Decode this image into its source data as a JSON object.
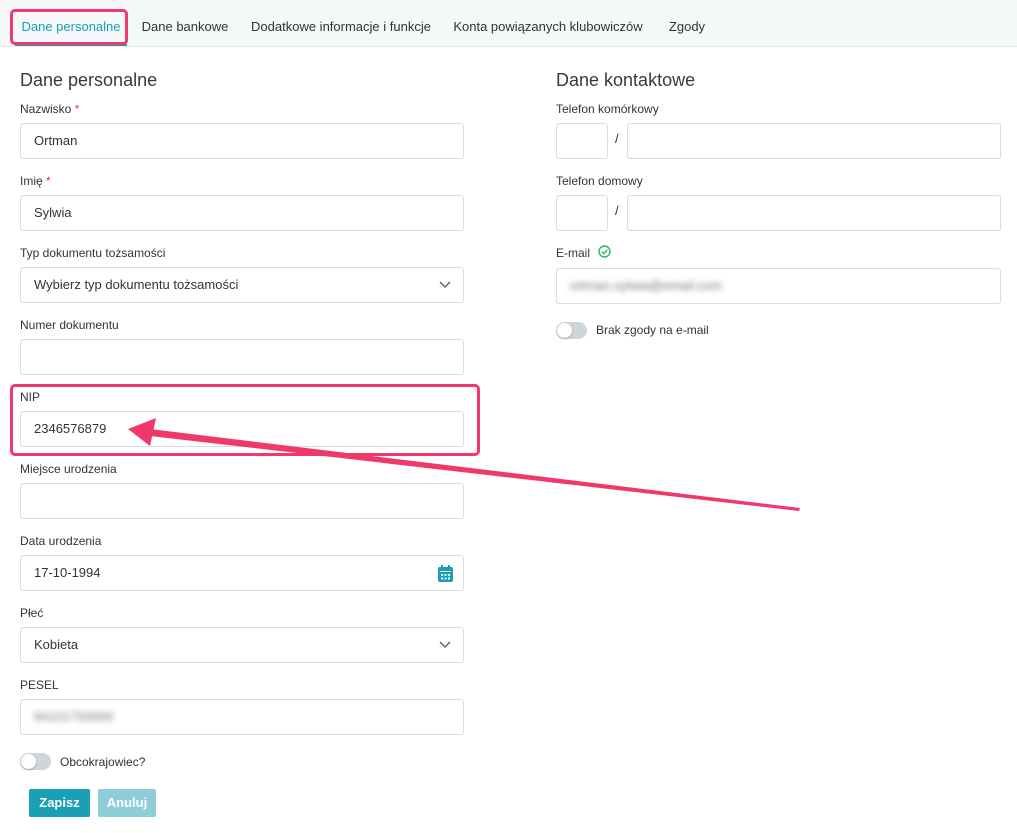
{
  "tabs": [
    {
      "label": "Dane personalne",
      "active": true
    },
    {
      "label": "Dane bankowe"
    },
    {
      "label": "Dodatkowe informacje i funkcje"
    },
    {
      "label": "Konta powiązanych klubowiczów"
    },
    {
      "label": "Zgody"
    }
  ],
  "personal": {
    "title": "Dane personalne",
    "surname": {
      "label": "Nazwisko",
      "required_mark": "*",
      "value": "Ortman"
    },
    "first_name": {
      "label": "Imię",
      "required_mark": "*",
      "value": "Sylwia"
    },
    "id_doc_type": {
      "label": "Typ dokumentu tożsamości",
      "value": "Wybierz typ dokumentu tożsamości"
    },
    "doc_number": {
      "label": "Numer dokumentu",
      "value": ""
    },
    "nip": {
      "label": "NIP",
      "value": "2346576879"
    },
    "birthplace": {
      "label": "Miejsce urodzenia",
      "value": ""
    },
    "birthdate": {
      "label": "Data urodzenia",
      "value": "17-10-1994"
    },
    "gender": {
      "label": "Płeć",
      "value": "Kobieta"
    },
    "pesel": {
      "label": "PESEL",
      "value": "94101700000"
    },
    "foreigner": {
      "label": "Obcokrajowiec?",
      "on": false
    }
  },
  "contact": {
    "title": "Dane kontaktowe",
    "mobile": {
      "label": "Telefon komórkowy",
      "prefix": "",
      "number": "",
      "separator": "/"
    },
    "home": {
      "label": "Telefon domowy",
      "prefix": "",
      "number": "",
      "separator": "/"
    },
    "email": {
      "label": "E-mail",
      "value": "ortman.sylwia@email.com"
    },
    "no_email_consent": {
      "label": "Brak zgody na e-mail",
      "on": false
    }
  },
  "actions": {
    "save": "Zapisz",
    "cancel": "Anuluj"
  },
  "colors": {
    "accent": "#1a9fb5",
    "highlight": "#f0386b",
    "required": "#e53935",
    "verified": "#2eb85c"
  }
}
